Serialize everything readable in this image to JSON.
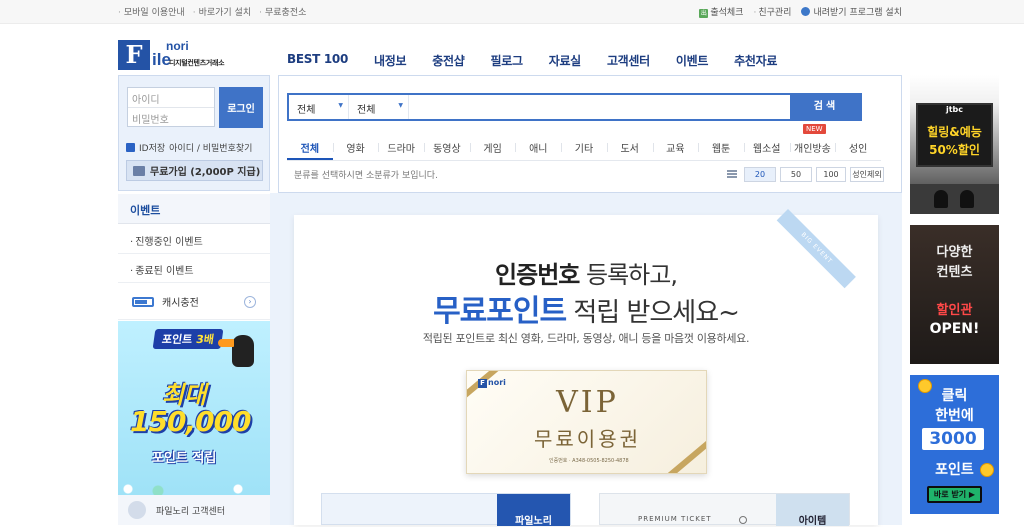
{
  "topbar": {
    "left_links": [
      "모바일 이용안내",
      "바로가기 설치",
      "무료충전소"
    ],
    "attendance": "출석체크",
    "friends": "친구관리",
    "download_program": "내려받기 프로그램 설치"
  },
  "logo": {
    "f": "F",
    "ile": "ile",
    "nori": "nori",
    "sub": "디지털컨텐츠거래소"
  },
  "nav": [
    "BEST 100",
    "내정보",
    "충전샵",
    "필로그",
    "자료실",
    "고객센터",
    "이벤트",
    "추천자료"
  ],
  "login": {
    "id_placeholder": "아이디",
    "pw_placeholder": "비밀번호",
    "login_button": "로그인",
    "save_id": "ID저장",
    "find": "아이디 / 비밀번호찾기",
    "signup": "무료가입 (2,000P 지급)"
  },
  "events": {
    "title": "이벤트",
    "items": [
      "진행중인 이벤트",
      "종료된 이벤트"
    ],
    "cash": "캐시충전",
    "customer_center": "파일노리 고객센터"
  },
  "side_banner": {
    "pill_prefix": "포인트 ",
    "pill_hi": "3배",
    "line1": "최대",
    "line2": "150,000",
    "line3": "포인트 적립"
  },
  "search": {
    "select1": "전체",
    "select2": "전체",
    "button": "검색",
    "categories": [
      "전체",
      "영화",
      "드라마",
      "동영상",
      "게임",
      "애니",
      "기타",
      "도서",
      "교육",
      "웹툰",
      "웹소설",
      "개인방송",
      "성인"
    ],
    "active_category": "전체",
    "new_badge": "NEW",
    "hint": "분류를 선택하시면 소분류가 보입니다.",
    "page_sizes": [
      "20",
      "50",
      "100"
    ],
    "adult_toggle": "성인제외"
  },
  "promo": {
    "ribbon": "BIG EVENT",
    "h1_bold": "인증번호",
    "h1_rest": " 등록하고,",
    "h2_bold": "무료포인트",
    "h2_rest": " 적립 받으세요~",
    "sub": "적립된 포인트로 최신 영화, 드라마, 동영상, 애니 등을 마음껏 이용하세요.",
    "vip_logo": "nori",
    "vip_title": "VIP",
    "vip_sub": "무료이용권",
    "vip_code": "인증번호 · A348-0505-8250-4878",
    "card_left_tag": "파일노리",
    "card_right_label": "PREMIUM TICKET",
    "card_right_tag": "아이템"
  },
  "right_banners": {
    "b1_brand": "jtbc",
    "b1_l1": "힐링&예능",
    "b1_l2": "50%할인",
    "b2_l1": "다양한",
    "b2_l2": "컨텐츠",
    "b2_l3": "할인관",
    "b2_l4": "OPEN!",
    "b3_l1": "클릭",
    "b3_l2": "한번에",
    "b3_num": "3000",
    "b3_l3": "포인트",
    "b3_btn": "바로 받기 ▶"
  }
}
